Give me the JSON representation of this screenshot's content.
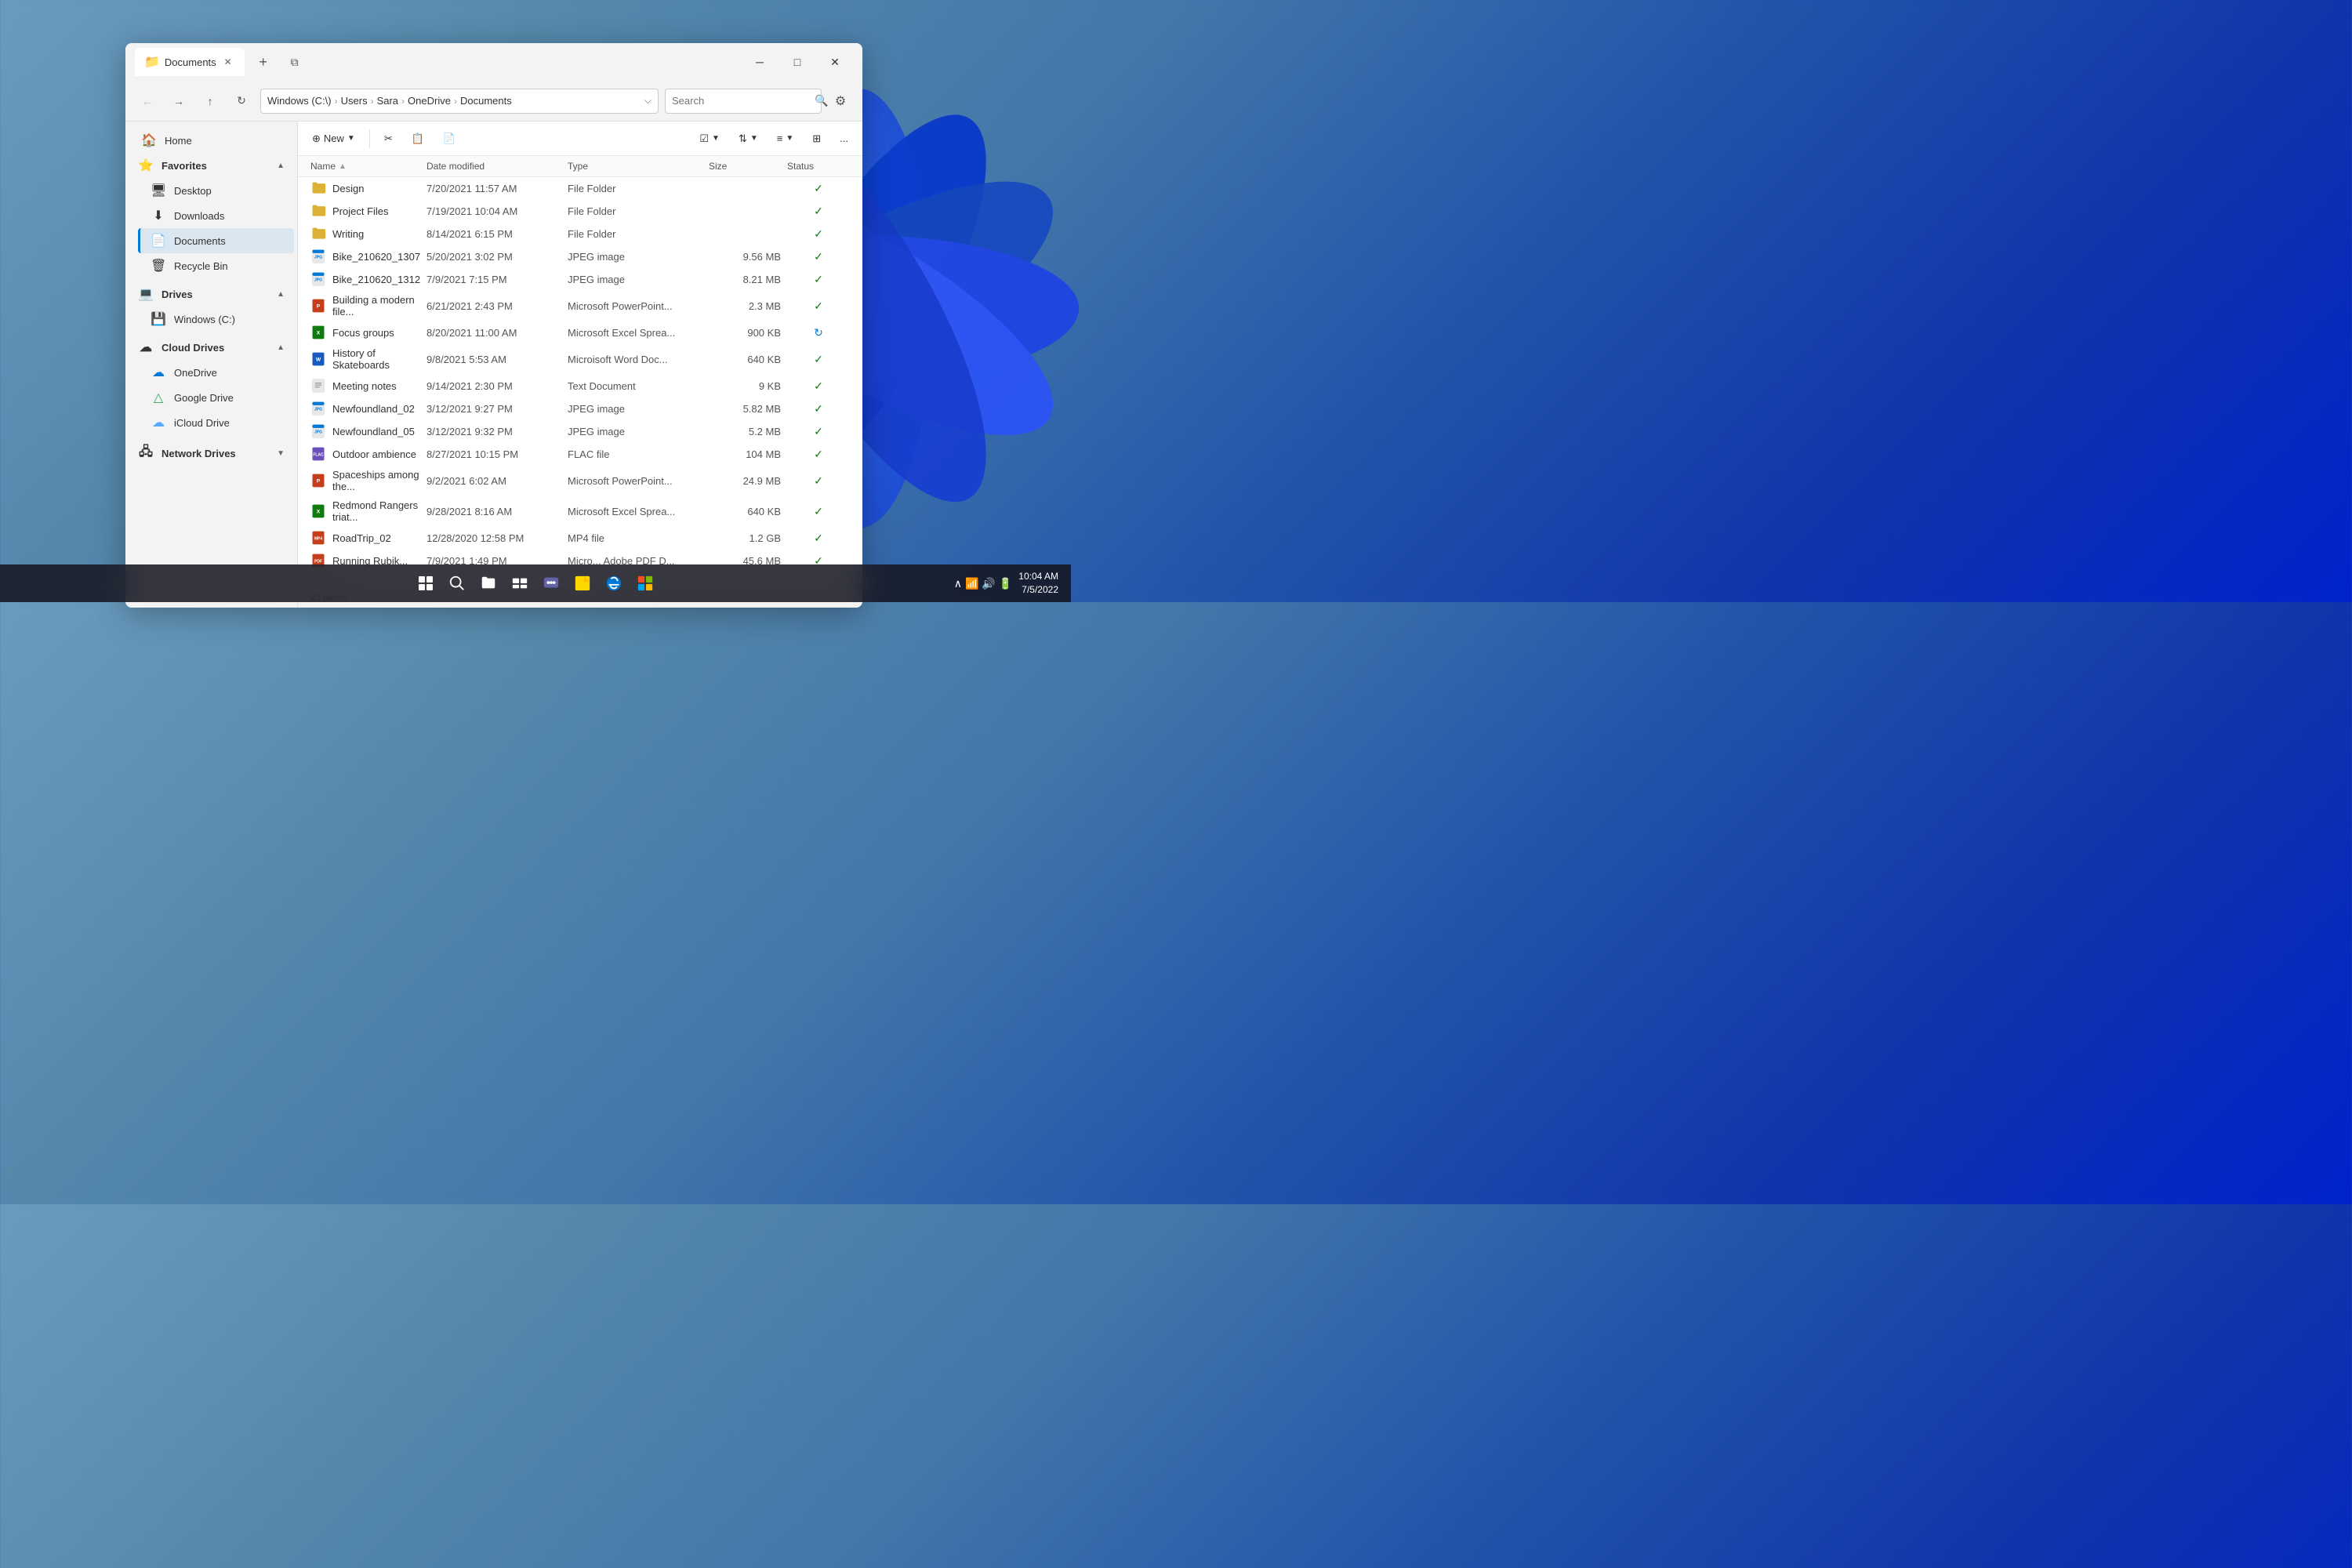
{
  "window": {
    "title": "Documents",
    "tab_icon": "📁"
  },
  "nav": {
    "breadcrumbs": [
      "Windows (C:\\)",
      "Users",
      "Sara",
      "OneDrive",
      "Documents"
    ],
    "search_placeholder": "Search",
    "search_value": ""
  },
  "sidebar": {
    "home_label": "Home",
    "favorites_label": "Favorites",
    "favorites_items": [
      {
        "label": "Desktop",
        "icon": "🖥"
      },
      {
        "label": "Downloads",
        "icon": "⬇"
      },
      {
        "label": "Documents",
        "icon": "📄",
        "active": true
      },
      {
        "label": "Recycle Bin",
        "icon": "🗑"
      }
    ],
    "drives_label": "Drives",
    "drives_items": [
      {
        "label": "Windows (C:)",
        "icon": "💻"
      }
    ],
    "cloud_drives_label": "Cloud Drives",
    "cloud_drives_items": [
      {
        "label": "OneDrive",
        "icon": "☁"
      },
      {
        "label": "Google Drive",
        "icon": "△"
      },
      {
        "label": "iCloud Drive",
        "icon": "☁"
      }
    ],
    "network_drives_label": "Network Drives"
  },
  "toolbar": {
    "new_label": "New",
    "more_label": "..."
  },
  "file_list": {
    "headers": [
      "Name",
      "Date modified",
      "Type",
      "Size",
      "Status"
    ],
    "items": [
      {
        "name": "Design",
        "date": "7/20/2021  11:57 AM",
        "type": "File Folder",
        "size": "",
        "status": "check",
        "icon_type": "folder"
      },
      {
        "name": "Project Files",
        "date": "7/19/2021  10:04 AM",
        "type": "File Folder",
        "size": "",
        "status": "check",
        "icon_type": "folder"
      },
      {
        "name": "Writing",
        "date": "8/14/2021  6:15 PM",
        "type": "File Folder",
        "size": "",
        "status": "check",
        "icon_type": "folder"
      },
      {
        "name": "Bike_210620_1307",
        "date": "5/20/2021  3:02 PM",
        "type": "JPEG image",
        "size": "9.56 MB",
        "status": "check",
        "icon_type": "jpeg"
      },
      {
        "name": "Bike_210620_1312",
        "date": "7/9/2021  7:15 PM",
        "type": "JPEG image",
        "size": "8.21 MB",
        "status": "check",
        "icon_type": "jpeg"
      },
      {
        "name": "Building a modern file...",
        "date": "6/21/2021  2:43 PM",
        "type": "Microsoft PowerPoint...",
        "size": "2.3 MB",
        "status": "check",
        "icon_type": "ppt"
      },
      {
        "name": "Focus groups",
        "date": "8/20/2021  11:00 AM",
        "type": "Microsoft Excel Sprea...",
        "size": "900 KB",
        "status": "sync",
        "icon_type": "excel"
      },
      {
        "name": "History of Skateboards",
        "date": "9/8/2021  5:53 AM",
        "type": "Microisoft Word Doc...",
        "size": "640 KB",
        "status": "check",
        "icon_type": "word"
      },
      {
        "name": "Meeting notes",
        "date": "9/14/2021  2:30 PM",
        "type": "Text Document",
        "size": "9 KB",
        "status": "check",
        "icon_type": "text"
      },
      {
        "name": "Newfoundland_02",
        "date": "3/12/2021  9:27 PM",
        "type": "JPEG image",
        "size": "5.82 MB",
        "status": "check",
        "icon_type": "jpeg"
      },
      {
        "name": "Newfoundland_05",
        "date": "3/12/2021  9:32 PM",
        "type": "JPEG image",
        "size": "5.2 MB",
        "status": "check",
        "icon_type": "jpeg"
      },
      {
        "name": "Outdoor ambience",
        "date": "8/27/2021  10:15 PM",
        "type": "FLAC file",
        "size": "104 MB",
        "status": "check",
        "icon_type": "flac"
      },
      {
        "name": "Spaceships among the...",
        "date": "9/2/2021  6:02 AM",
        "type": "Microsoft PowerPoint...",
        "size": "24.9 MB",
        "status": "check",
        "icon_type": "ppt"
      },
      {
        "name": "Redmond Rangers triat...",
        "date": "9/28/2021  8:16 AM",
        "type": "Microsoft Excel Sprea...",
        "size": "640 KB",
        "status": "check",
        "icon_type": "excel"
      },
      {
        "name": "RoadTrip_02",
        "date": "12/28/2020  12:58 PM",
        "type": "MP4 file",
        "size": "1.2 GB",
        "status": "check",
        "icon_type": "mp4"
      },
      {
        "name": "Running Rubik...",
        "date": "7/9/2021  1:49 PM",
        "type": "Micro... Adobe PDF D...",
        "size": "45.6 MB",
        "status": "check",
        "icon_type": "pdf"
      }
    ],
    "item_count": "21 items"
  },
  "taskbar": {
    "clock": "10:04 AM",
    "date": "7/5/2022",
    "icons": [
      "⊞",
      "🔍",
      "📁",
      "⬛",
      "💬",
      "📋",
      "🌐",
      "⊞"
    ]
  }
}
